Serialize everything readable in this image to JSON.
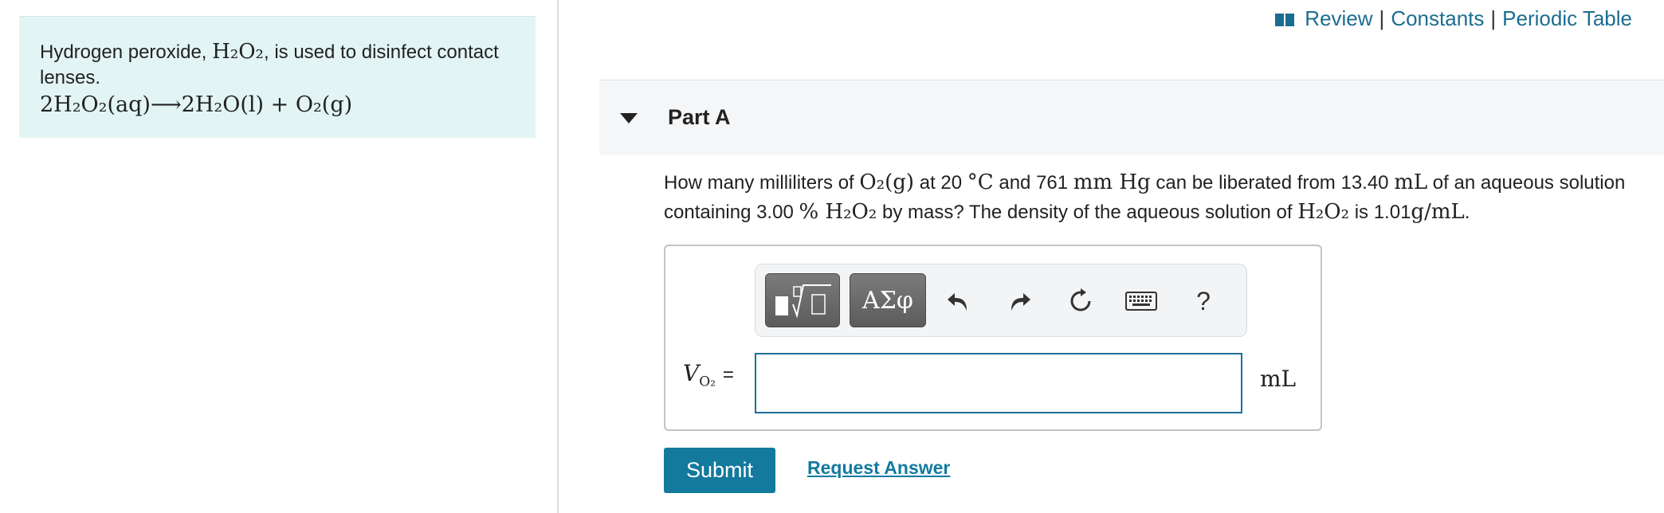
{
  "colors": {
    "accent": "#137a9e",
    "link": "#1b6d8f",
    "info_bg": "#e3f4f4",
    "header_bg": "#f5f6f7"
  },
  "intro": {
    "text_prefix": "Hydrogen peroxide, ",
    "formula": "H₂O₂",
    "text_suffix": ", is used to disinfect contact lenses.",
    "equation": "2H₂O₂(aq)⟶2H₂O(l) + O₂(g)"
  },
  "top_links": {
    "icon": "book-icon",
    "review": "Review",
    "sep1": "|",
    "constants": "Constants",
    "sep2": "|",
    "periodic_table": "Periodic Table"
  },
  "part": {
    "title": "Part A",
    "icon": "caret-down-icon"
  },
  "question": {
    "p1": "How many milliliters of ",
    "o2": "O₂(g)",
    "p2": " at 20 ",
    "temp_unit": "°C",
    "p3": " and 761 ",
    "press_unit": "mm Hg",
    "p4": " can be liberated from 13.40 ",
    "vol_unit": "mL",
    "p5": " of an aqueous solution containing 3.00 ",
    "percent": "%",
    "h2o2_a": " H₂O₂",
    "p6": " by mass? The density of the aqueous solution of ",
    "h2o2_b": "H₂O₂",
    "p7": " is 1.01",
    "density_unit": "g/mL",
    "p8": "."
  },
  "toolbar": {
    "templates_icon": "templates-icon",
    "symbols_label": "ΑΣφ",
    "undo_icon": "undo-icon",
    "redo_icon": "redo-icon",
    "reset_icon": "reset-icon",
    "keyboard_icon": "keyboard-icon",
    "help_label": "?"
  },
  "answer": {
    "variable": "V",
    "subscript": "O₂",
    "equals": "=",
    "value": "",
    "placeholder": "",
    "unit": "mL"
  },
  "actions": {
    "submit": "Submit",
    "request_answer": "Request Answer"
  }
}
